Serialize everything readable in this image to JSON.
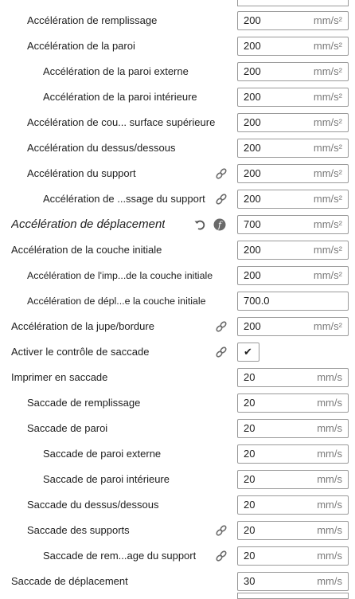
{
  "units": {
    "accel": "mm/s²",
    "jerk": "mm/s"
  },
  "settings": [
    {
      "label": "Accélération de remplissage",
      "value": "200",
      "unit": "mm/s²"
    },
    {
      "label": "Accélération de la paroi",
      "value": "200",
      "unit": "mm/s²"
    },
    {
      "label": "Accélération de la paroi externe",
      "value": "200",
      "unit": "mm/s²"
    },
    {
      "label": "Accélération de la paroi intérieure",
      "value": "200",
      "unit": "mm/s²"
    },
    {
      "label": "Accélération de cou... surface supérieure",
      "value": "200",
      "unit": "mm/s²"
    },
    {
      "label": "Accélération du dessus/dessous",
      "value": "200",
      "unit": "mm/s²"
    },
    {
      "label": "Accélération du support",
      "value": "200",
      "unit": "mm/s²"
    },
    {
      "label": "Accélération de ...ssage du support",
      "value": "200",
      "unit": "mm/s²"
    },
    {
      "label": "Accélération de déplacement",
      "value": "700",
      "unit": "mm/s²"
    },
    {
      "label": "Accélération de la couche initiale",
      "value": "200",
      "unit": "mm/s²"
    },
    {
      "label": "Accélération de l'imp...de la couche initiale",
      "value": "200",
      "unit": "mm/s²"
    },
    {
      "label": "Accélération de dépl...e la couche initiale",
      "value": "700.0",
      "unit": ""
    },
    {
      "label": "Accélération de la jupe/bordure",
      "value": "200",
      "unit": "mm/s²"
    },
    {
      "label": "Activer le contrôle de saccade",
      "checked": true
    },
    {
      "label": "Imprimer en saccade",
      "value": "20",
      "unit": "mm/s"
    },
    {
      "label": "Saccade de remplissage",
      "value": "20",
      "unit": "mm/s"
    },
    {
      "label": "Saccade de paroi",
      "value": "20",
      "unit": "mm/s"
    },
    {
      "label": "Saccade de paroi externe",
      "value": "20",
      "unit": "mm/s"
    },
    {
      "label": "Saccade de paroi intérieure",
      "value": "20",
      "unit": "mm/s"
    },
    {
      "label": "Saccade du dessus/dessous",
      "value": "20",
      "unit": "mm/s"
    },
    {
      "label": "Saccade des supports",
      "value": "20",
      "unit": "mm/s"
    },
    {
      "label": "Saccade de rem...age du support",
      "value": "20",
      "unit": "mm/s"
    },
    {
      "label": "Saccade de déplacement",
      "value": "30",
      "unit": "mm/s"
    }
  ],
  "icons": {
    "link": "link-icon",
    "reset": "reset-icon",
    "function": "function-icon"
  },
  "checkmark": "✔"
}
